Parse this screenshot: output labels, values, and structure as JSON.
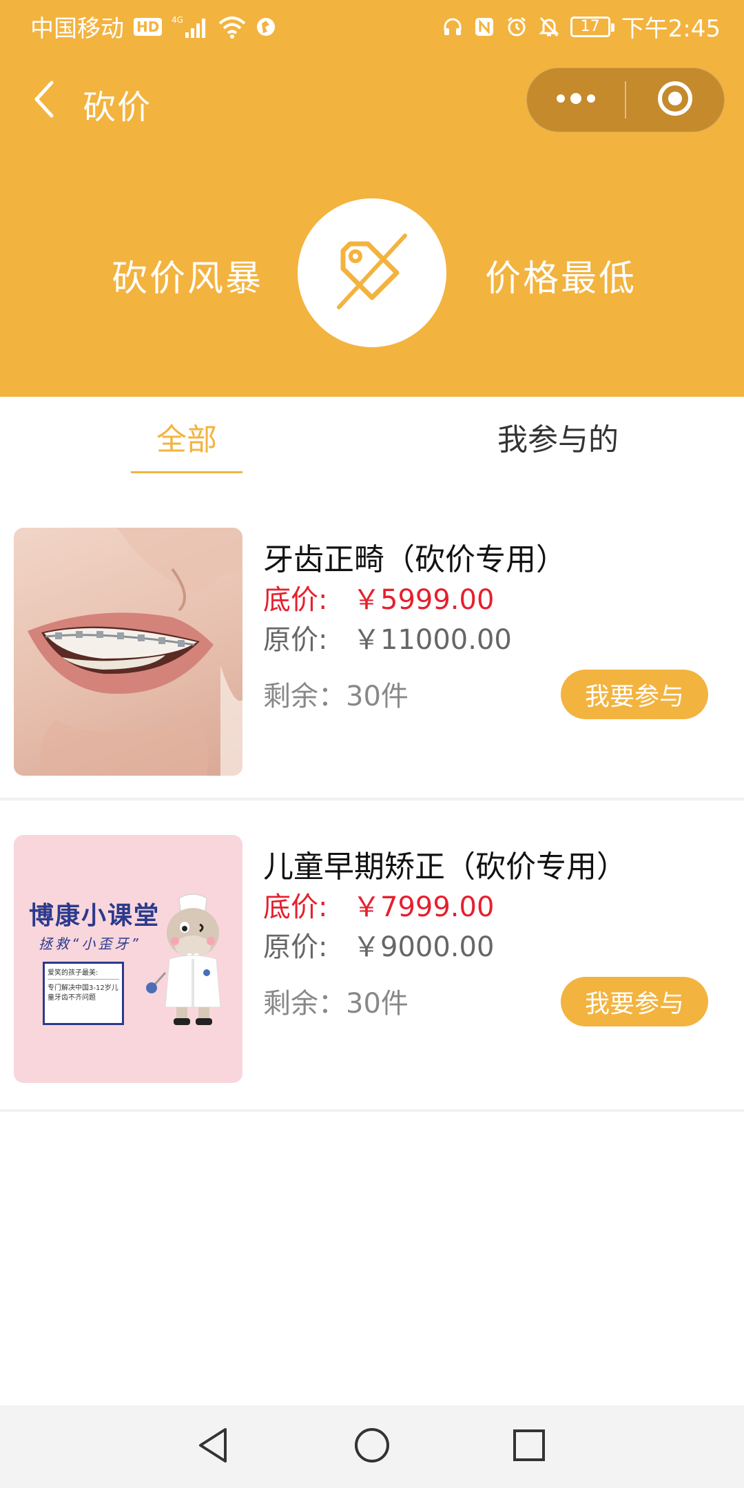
{
  "status_bar": {
    "carrier": "中国移动",
    "hd_badge": "HD",
    "network": "4G",
    "battery": "17",
    "time": "下午2:45",
    "icons": [
      "signal-icon",
      "wifi-icon",
      "vpn-icon",
      "headphones-icon",
      "nfc-icon",
      "alarm-icon",
      "mute-icon"
    ]
  },
  "navbar": {
    "title": "砍价",
    "back_icon": "chevron-left-icon",
    "more_icon": "more-dots-icon",
    "close_icon": "target-circle-icon"
  },
  "banner": {
    "left_text": "砍价风暴",
    "right_text": "价格最低",
    "center_icon": "price-tag-slash-icon"
  },
  "tabs": [
    {
      "label": "全部",
      "active": true
    },
    {
      "label": "我参与的",
      "active": false
    }
  ],
  "products": [
    {
      "name": "牙齿正畸（砍价专用）",
      "floor_label": "底价:",
      "floor_price": "￥5999.00",
      "orig_label": "原价:",
      "orig_price": "￥11000.00",
      "stock": "剩余：30件",
      "button": "我要参与"
    },
    {
      "name": "儿童早期矫正（砍价专用）",
      "floor_label": "底价:",
      "floor_price": "￥7999.00",
      "orig_label": "原价:",
      "orig_price": "￥9000.00",
      "stock": "剩余：30件",
      "button": "我要参与",
      "poster": {
        "title": "博康小课堂",
        "subtitle": "拯救“小歪牙”",
        "box_line1": "爱笑的孩子最美:",
        "box_line2": "专门解决中国3-12岁儿童牙齿不齐问题"
      }
    }
  ],
  "colors": {
    "brand": "#F3B33F",
    "price_red": "#E5202E",
    "capsule": "#C48A2C"
  },
  "system_nav": [
    "back-triangle-icon",
    "home-circle-icon",
    "recents-square-icon"
  ]
}
